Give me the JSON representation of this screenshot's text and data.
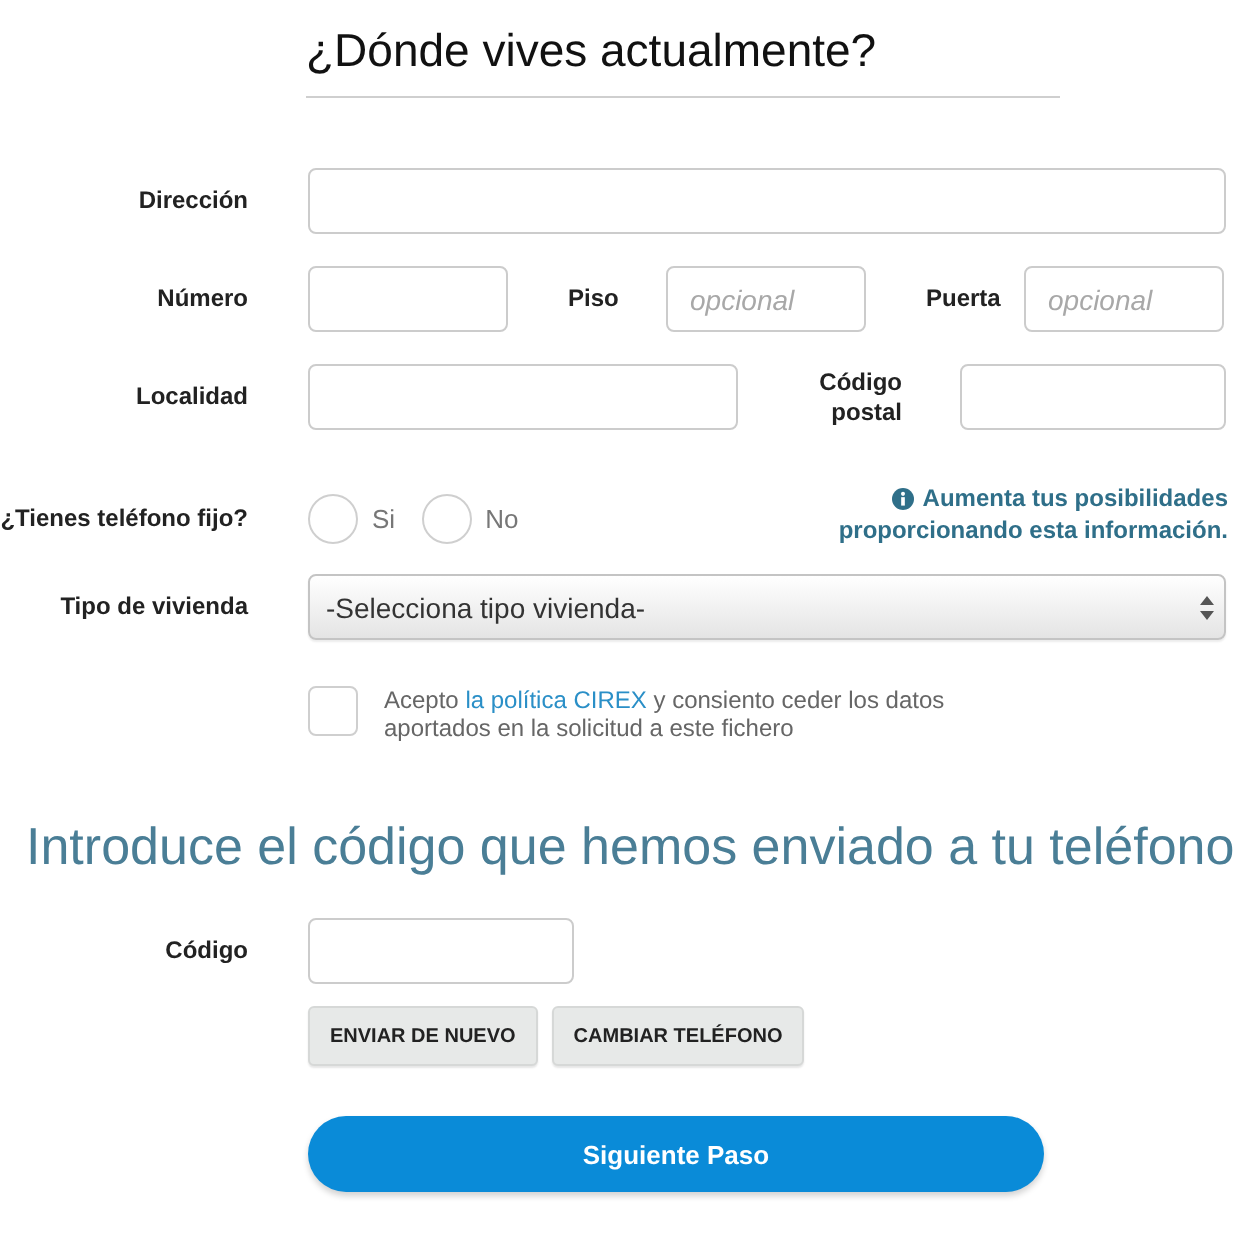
{
  "address_section": {
    "title": "¿Dónde vives actualmente?"
  },
  "address": {
    "label": "Dirección"
  },
  "number_row": [
    {
      "label": "Número"
    },
    {
      "label": "Piso",
      "placeholder": "opcional"
    },
    {
      "label": "Puerta",
      "placeholder": "opcional"
    }
  ],
  "locality_row": [
    {
      "label": "Localidad"
    },
    {
      "label": "Código postal"
    }
  ],
  "landline": {
    "label": "¿Tienes teléfono fijo?",
    "options": [
      {
        "label": "Si",
        "selected": false
      },
      {
        "label": "No",
        "selected": false
      }
    ],
    "hint_lines": [
      "Aumenta tus posibilidades",
      "proporcionando esta información."
    ]
  },
  "housing_type": {
    "label": "Tipo de vivienda",
    "value": "-Selecciona tipo vivienda-"
  },
  "consent": {
    "checked": false,
    "text_before": "Acepto ",
    "link": "la política CIREX",
    "text_after": " y consiento ceder los datos aportados en la solicitud a este fichero"
  },
  "code_section": {
    "title": "Introduce el código que hemos enviado a tu teléfono",
    "label": "Código",
    "buttons": [
      "ENVIAR DE NUEVO",
      "CAMBIAR TELÉFONO"
    ]
  },
  "submit": {
    "label": "Siguiente Paso"
  }
}
